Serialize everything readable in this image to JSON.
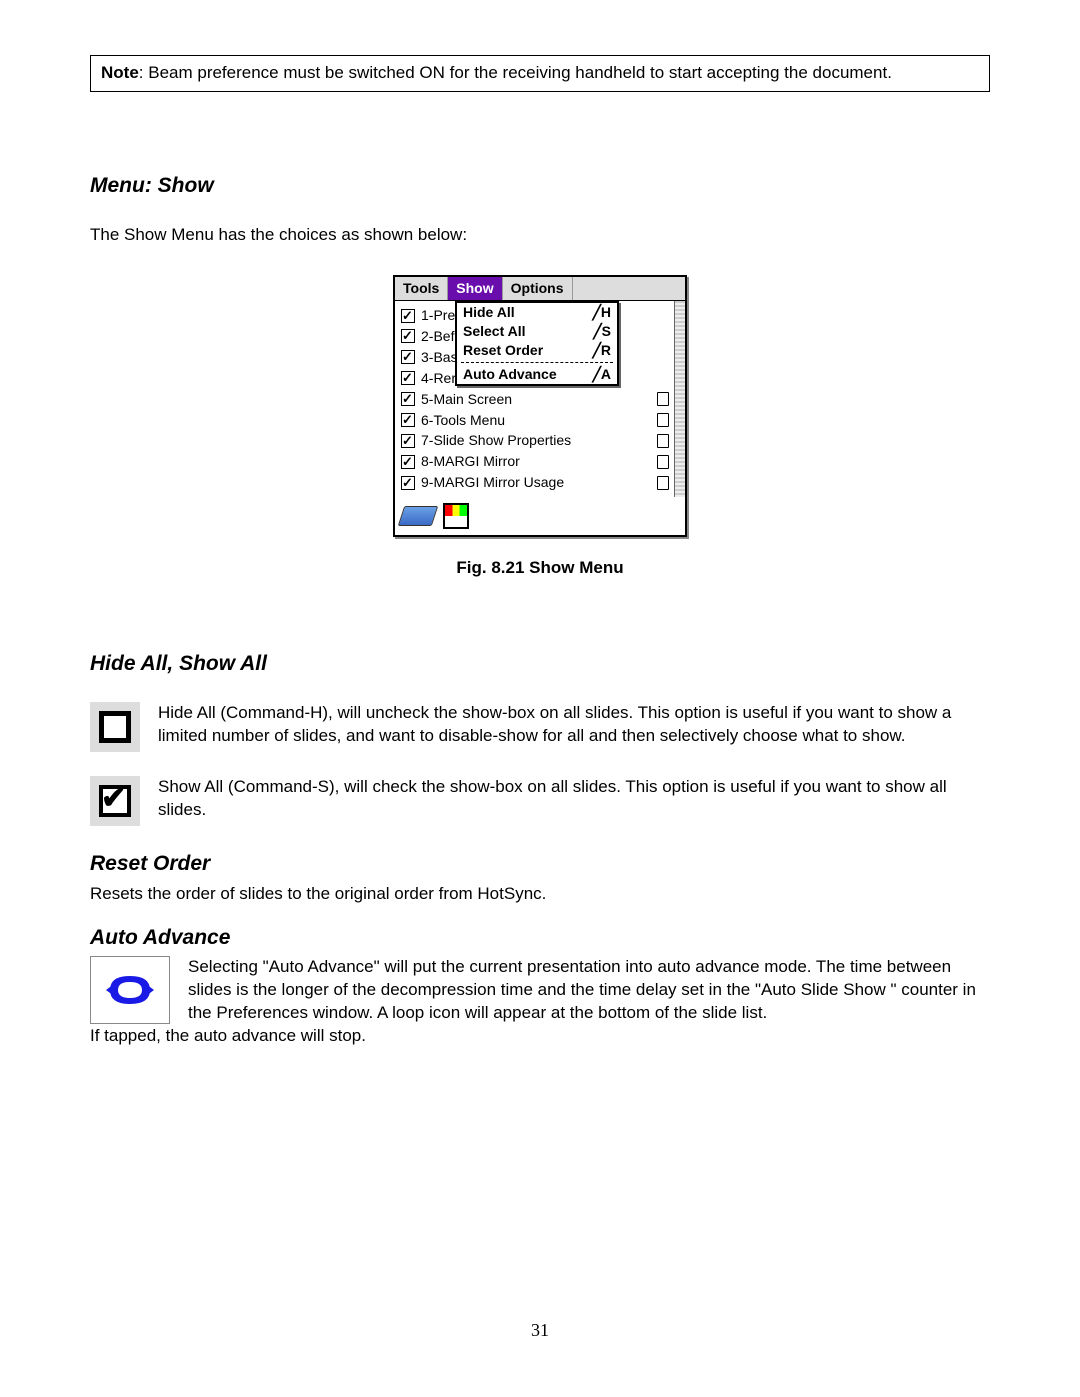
{
  "note": {
    "label": "Note",
    "text": ": Beam preference must be switched ON for the receiving handheld to start accepting the document."
  },
  "sections": {
    "menu_show": {
      "heading": "Menu: Show",
      "intro": "The Show Menu has the choices as shown below:"
    },
    "hide_show": {
      "heading": "Hide All, Show All",
      "hide_text": "Hide All (Command-H), will uncheck the show-box on all slides.  This option is useful if you want to show a limited number of slides, and want to disable-show for all and then selectively   choose what to show.",
      "show_text": "Show All (Command-S), will check the show-box on all slides.  This option is useful if you want to show all slides."
    },
    "reset_order": {
      "heading": "Reset Order",
      "text": "Resets the order of slides to the original order from HotSync."
    },
    "auto_advance": {
      "heading": "Auto Advance",
      "text_wrapped": "Selecting \"Auto Advance\" will put the current presentation into auto advance mode.  The time between slides is the longer of the decompression time and the time delay set in the \"Auto Slide Show \" counter in the Preferences window.  A loop icon will appear at the bottom of the slide list.",
      "text_after": "If tapped, the auto advance will stop."
    }
  },
  "figure": {
    "caption": "Fig. 8.21 Show Menu",
    "menubar": {
      "tools": "Tools",
      "show": "Show",
      "options": "Options"
    },
    "dropdown": [
      {
        "label": "Hide All",
        "shortcut": "╱H"
      },
      {
        "label": "Select All",
        "shortcut": "╱S"
      },
      {
        "label": "Reset Order",
        "shortcut": "╱R"
      },
      {
        "label": "Auto Advance",
        "shortcut": "╱A"
      }
    ],
    "slides": [
      "1-Pre",
      "2-Bef",
      "3-Bas",
      "4-Rer",
      "5-Main Screen",
      "6-Tools Menu",
      "7-Slide Show Properties",
      "8-MARGI Mirror",
      "9-MARGI Mirror Usage"
    ]
  },
  "page_number": "31"
}
